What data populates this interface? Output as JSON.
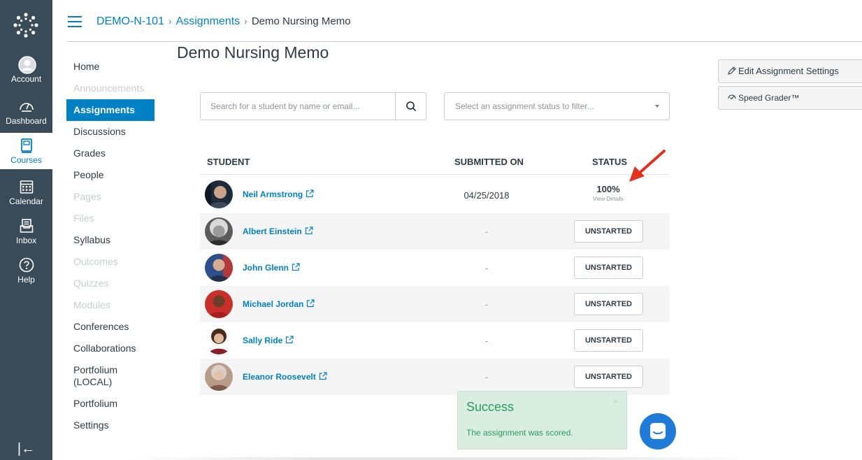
{
  "global_nav": {
    "items": [
      {
        "label": "Account",
        "icon": "account-icon"
      },
      {
        "label": "Dashboard",
        "icon": "dashboard-icon"
      },
      {
        "label": "Courses",
        "icon": "courses-icon",
        "active": true
      },
      {
        "label": "Calendar",
        "icon": "calendar-icon"
      },
      {
        "label": "Inbox",
        "icon": "inbox-icon"
      },
      {
        "label": "Help",
        "icon": "help-icon"
      }
    ],
    "collapse_glyph": "|←"
  },
  "breadcrumb": {
    "course": "DEMO-N-101",
    "section": "Assignments",
    "current": "Demo Nursing Memo",
    "separator": "›"
  },
  "course_nav": {
    "items": [
      {
        "label": "Home",
        "state": "normal"
      },
      {
        "label": "Announcements",
        "state": "disabled"
      },
      {
        "label": "Assignments",
        "state": "active"
      },
      {
        "label": "Discussions",
        "state": "normal"
      },
      {
        "label": "Grades",
        "state": "normal"
      },
      {
        "label": "People",
        "state": "normal"
      },
      {
        "label": "Pages",
        "state": "disabled"
      },
      {
        "label": "Files",
        "state": "disabled"
      },
      {
        "label": "Syllabus",
        "state": "normal"
      },
      {
        "label": "Outcomes",
        "state": "disabled"
      },
      {
        "label": "Quizzes",
        "state": "disabled"
      },
      {
        "label": "Modules",
        "state": "disabled"
      },
      {
        "label": "Conferences",
        "state": "normal"
      },
      {
        "label": "Collaborations",
        "state": "normal"
      },
      {
        "label": "Portfolium (LOCAL)",
        "state": "normal"
      },
      {
        "label": "Portfolium",
        "state": "normal"
      },
      {
        "label": "Settings",
        "state": "normal"
      }
    ]
  },
  "page": {
    "title": "Demo Nursing Memo"
  },
  "filters": {
    "search_placeholder": "Search for a student by name or email...",
    "status_placeholder": "Select an assignment status to filter..."
  },
  "table": {
    "headers": {
      "student": "STUDENT",
      "submitted_on": "SUBMITTED ON",
      "status": "STATUS"
    },
    "rows": [
      {
        "name": "Neil Armstrong",
        "submitted": "04/25/2018",
        "status": "100%",
        "status_detail": "View Details"
      },
      {
        "name": "Albert Einstein",
        "submitted": "-",
        "status": "UNSTARTED"
      },
      {
        "name": "John Glenn",
        "submitted": "-",
        "status": "UNSTARTED"
      },
      {
        "name": "Michael Jordan",
        "submitted": "-",
        "status": "UNSTARTED"
      },
      {
        "name": "Sally Ride",
        "submitted": "-",
        "status": "UNSTARTED"
      },
      {
        "name": "Eleanor Roosevelt",
        "submitted": "-",
        "status": "UNSTARTED"
      }
    ]
  },
  "sidebar_actions": {
    "edit_settings": "Edit Assignment Settings",
    "speed_grader": "Speed Grader™"
  },
  "toast": {
    "title": "Success",
    "message": "The assignment was scored.",
    "close": "×"
  },
  "colors": {
    "brand_blue": "#0081c6",
    "nav_dark": "#394b58",
    "success_bg": "#d9ede0",
    "success_text": "#2a9d5d",
    "arrow_red": "#e0321e",
    "chat_blue": "#1f7bd8"
  }
}
